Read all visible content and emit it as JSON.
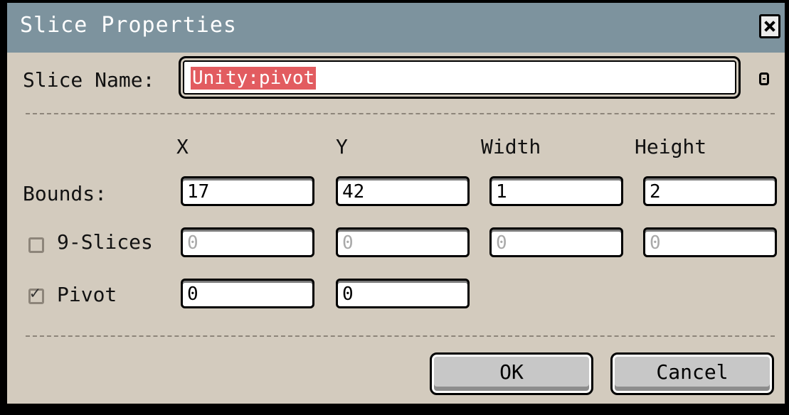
{
  "dialog": {
    "title": "Slice Properties",
    "close_label": "Close"
  },
  "slice_name": {
    "label": "Slice Name:",
    "value": "Unity:pivot"
  },
  "columns": {
    "x": "X",
    "y": "Y",
    "width": "Width",
    "height": "Height"
  },
  "bounds": {
    "label": "Bounds:",
    "x": "17",
    "y": "42",
    "width": "1",
    "height": "2"
  },
  "nine_slices": {
    "label": "9-Slices",
    "checked": false,
    "x": "0",
    "y": "0",
    "width": "0",
    "height": "0"
  },
  "pivot": {
    "label": "Pivot",
    "checked": true,
    "x": "0",
    "y": "0"
  },
  "buttons": {
    "ok": "OK",
    "cancel": "Cancel"
  }
}
